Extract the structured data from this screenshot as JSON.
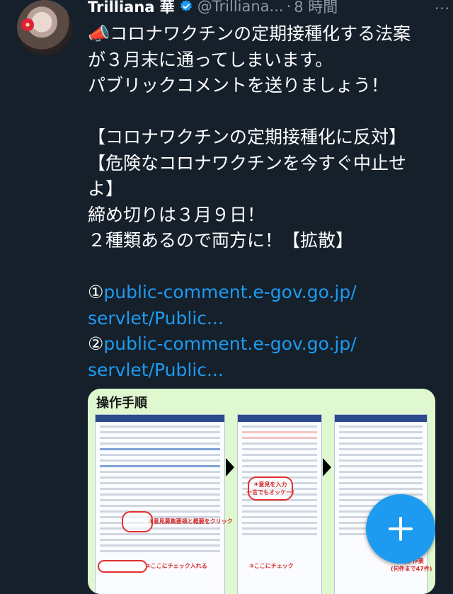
{
  "header": {
    "name": "Trilliana 華",
    "handle": "@Trilliana...",
    "separator": "·",
    "time": "8 時間",
    "more": "···"
  },
  "tweet": {
    "lines": [
      "📣コロナワクチンの定期接種化する法案",
      "が３月末に通ってしまいます。",
      "パブリックコメントを送りましょう！",
      "",
      "【コロナワクチンの定期接種化に反対】",
      "【危険なコロナワクチンを今すぐ中止せ",
      "よ】",
      "締め切りは３月９日！",
      "２種類あるので両方に！【拡散】",
      ""
    ],
    "link1_marker": "①",
    "link1_line1": "public-comment.e-gov.go.jp/",
    "link1_line2": "servlet/Public...",
    "link2_marker": "②",
    "link2_line1": "public-comment.e-gov.go.jp/",
    "link2_line2": "servlet/Public..."
  },
  "card": {
    "title": "操作手順",
    "annotation1": "①意見募集要領と概要をクリック",
    "annotation2": "②ここにチェック入れる",
    "annotation3": "④意見を入力\n一言でもオッケー!",
    "annotation4": "③ここにチェック",
    "annotation5": "⑤意見が作業\n(何件まで47件)"
  },
  "fab": {
    "icon": "plus-icon"
  },
  "colors": {
    "background": "#15202b",
    "link": "#1d9bf0",
    "muted": "#8b98a5",
    "verified": "#1d9bf0"
  }
}
